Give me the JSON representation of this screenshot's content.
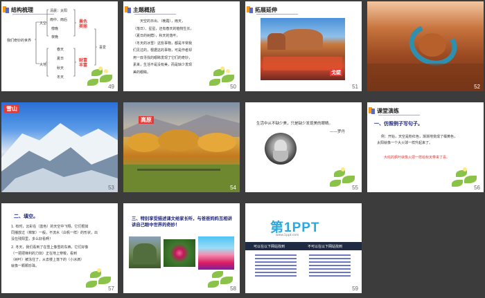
{
  "slides": [
    {
      "num": "49",
      "title": "结构梳理",
      "root": "我们奇妙的世界",
      "branch_sky": "天空",
      "branch_earth": "大地",
      "sky_items": [
        "清晨：太阳",
        "雨中、雨后",
        "傍晚",
        "夜晚"
      ],
      "earth_items": [
        "春天",
        "夏日",
        "秋天",
        "冬天"
      ],
      "sky_result": "景色美丽",
      "earth_result": "财富丰富",
      "final": "喜爱"
    },
    {
      "num": "50",
      "title": "主题概括",
      "lines": [
        "天空的日出、（晚霞），雨天，",
        "（落日）、星星，还有春天的植物生长，",
        "（夏日的树荫），秋天的落叶，",
        "（冬天的冰雪）这些事物，都是平常我",
        "们见过的，根据这的事物，可是作者却",
        "用一双寻找的眼睛发现了它们的奇妙，",
        "素来，生活不是没有美，而是缺少发现",
        "美的眼睛。"
      ]
    },
    {
      "num": "51",
      "title": "拓展延伸",
      "caption": "戈壁"
    },
    {
      "num": "52"
    },
    {
      "num": "53",
      "caption": "雪山"
    },
    {
      "num": "54",
      "caption": "高原"
    },
    {
      "num": "55",
      "quote": "生活中从不缺少美，只是缺少发现美的眼睛。",
      "author": "——罗丹"
    },
    {
      "num": "56",
      "title": "课堂演练",
      "heading": "一、仿照例子写句子。",
      "example": [
        "例：开始，天空是粉红色，渐渐地变成了橘黄色，",
        "太阳就像一个大火球一样升起来了。"
      ],
      "task": "大红的枫叶就像火把一样给秋天带来了喜。"
    },
    {
      "num": "57",
      "heading": "二、填空。",
      "lines": [
        "1. 有时，云彩在（蓝色）的天空中飞翔，它们根如",
        "同播放过（棉絮）一般，不流水（白帆一样）的形状，出",
        "没在残阳里，多么好看啊！",
        "2. 冬天，我们看到了在雪上像雪的东西，它们好像",
        "（一把把锋利的刀剑）正在地上穿梭，看到",
        "（树叶）被冻住了，从去楼上落下的（小冰滴）",
        "就像一颗颗珍珠。"
      ]
    },
    {
      "num": "58",
      "heading": "三、特别享受描述课文给家长听，与爸爸妈妈互相讲讲自己眼中世界的奇妙！"
    },
    {
      "num": "59",
      "logo": "第1PPT",
      "url": "www.1ppt.com",
      "left_title": "可以在以下网站找到",
      "right_title": "不可以在以下网站找到"
    }
  ],
  "colors": {
    "red": "#e53935",
    "orange": "#ff9800",
    "indigo": "#5c6bc0",
    "background": "#3c3c3c"
  }
}
